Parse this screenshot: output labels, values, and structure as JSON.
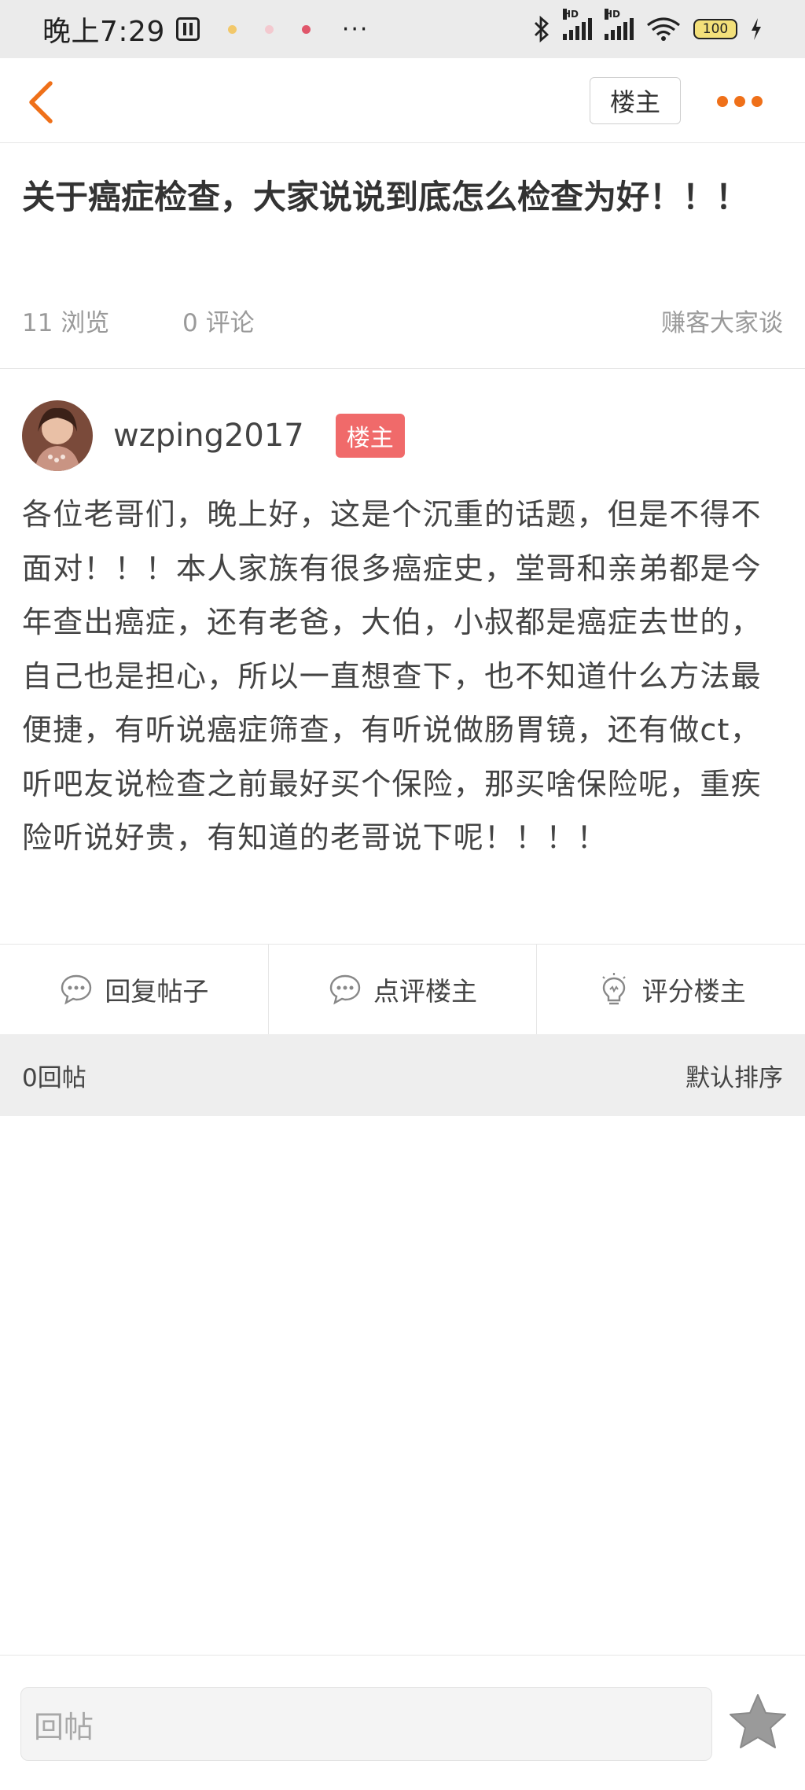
{
  "status_bar": {
    "time": "晚上7:29",
    "more": "···",
    "signal_label_1": "HD",
    "signal_label_2": "HD",
    "battery": "100"
  },
  "nav": {
    "back_icon": "chevron-left-icon",
    "op_filter_label": "楼主",
    "more_icon": "more-dots-icon",
    "accent_color": "#ef7019"
  },
  "post": {
    "title": "关于癌症检查，大家说说到底怎么检查为好！！！",
    "views": "11 浏览",
    "comments": "0 评论",
    "source": "赚客大家谈",
    "author": {
      "name": "wzping2017",
      "badge": "楼主",
      "badge_color": "#f06a6a"
    },
    "body": "各位老哥们，晚上好，这是个沉重的话题，但是不得不面对！！！本人家族有很多癌症史，堂哥和亲弟都是今年查出癌症，还有老爸，大伯，小叔都是癌症去世的，自己也是担心，所以一直想查下，也不知道什么方法最便捷，有听说癌症筛查，有听说做肠胃镜，还有做ct，听吧友说检查之前最好买个保险，那买啥保险呢，重疾险听说好贵，有知道的老哥说下呢！！！！"
  },
  "actions": [
    {
      "label": "回复帖子",
      "icon": "comment-bubble-icon"
    },
    {
      "label": "点评楼主",
      "icon": "comment-bubble-icon"
    },
    {
      "label": "评分楼主",
      "icon": "lightbulb-icon"
    }
  ],
  "replies": {
    "count_label": "0回帖",
    "sort_label": "默认排序"
  },
  "bottom": {
    "reply_placeholder": "回帖",
    "favorite_icon": "star-icon"
  }
}
